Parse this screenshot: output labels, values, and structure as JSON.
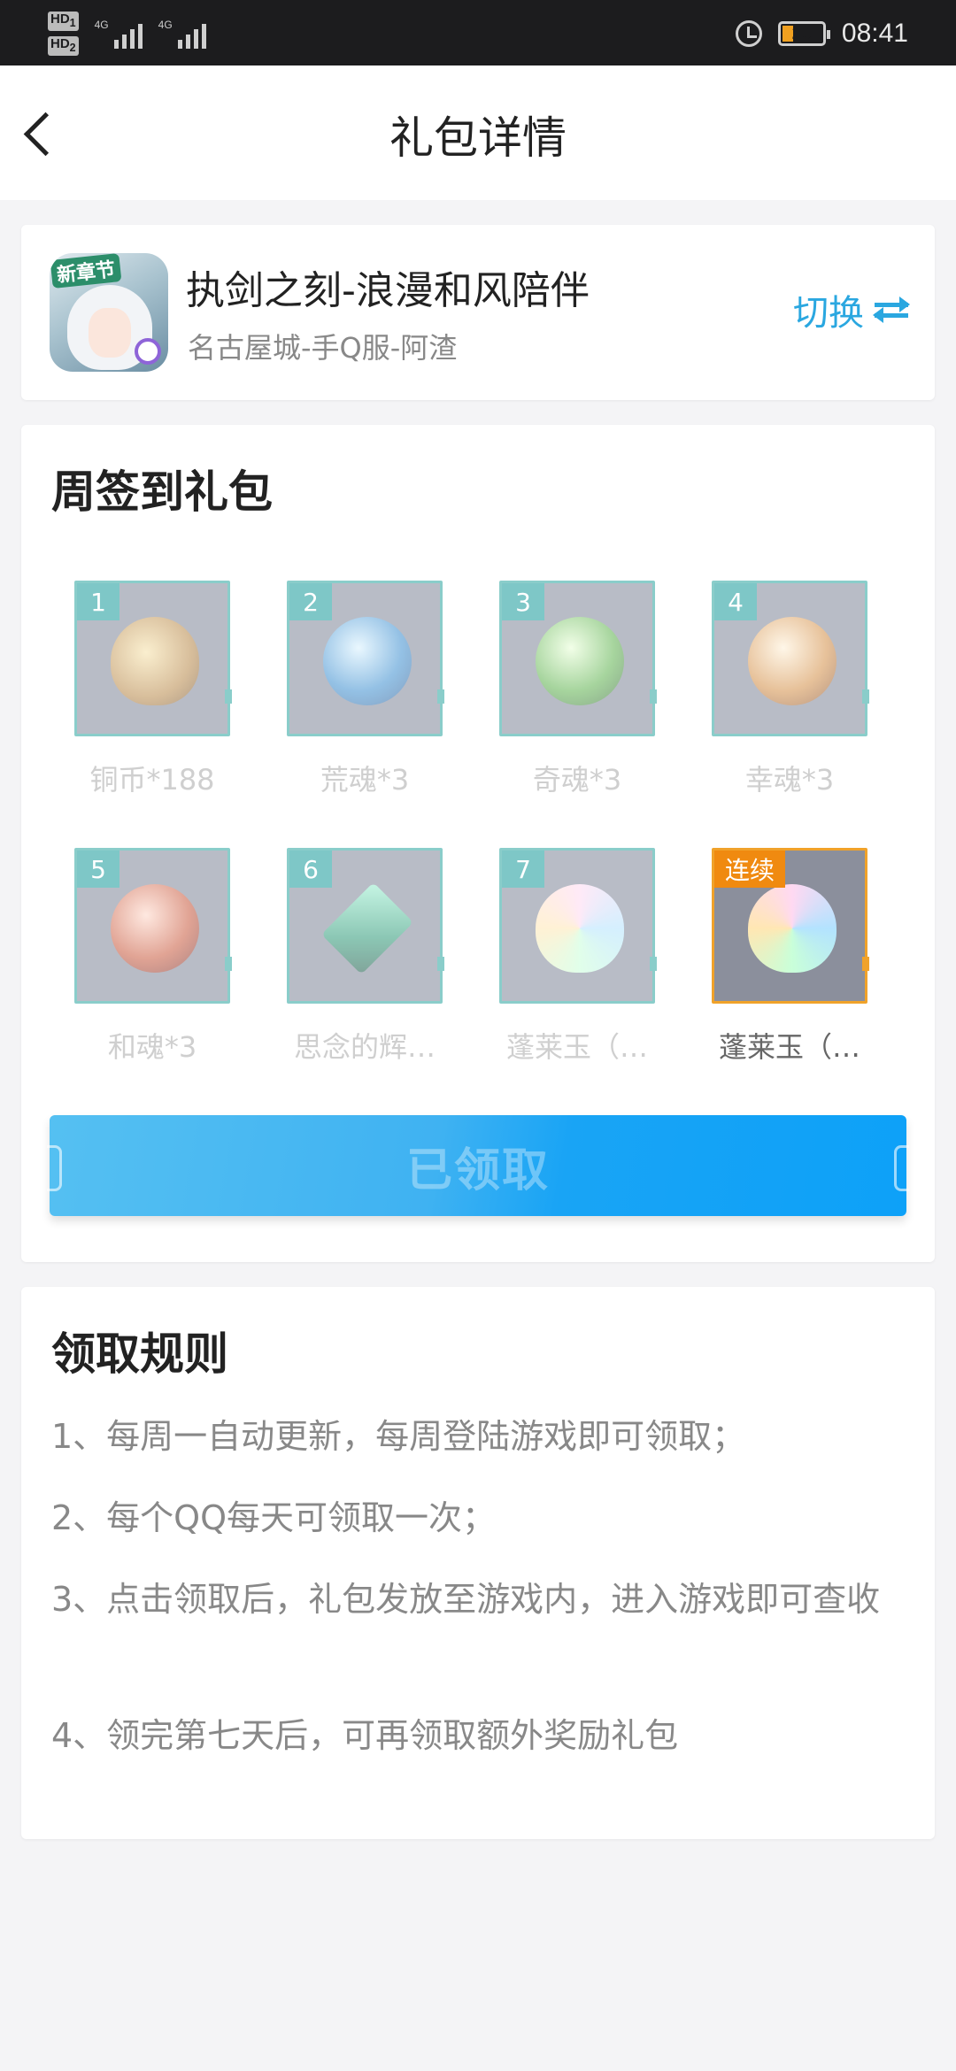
{
  "status_bar": {
    "hd1": "HD",
    "hd1_sub": "1",
    "hd2": "HD",
    "hd2_sub": "2",
    "net1": "4G",
    "net2": "4G",
    "battery": "20",
    "time": "08:41"
  },
  "header": {
    "title": "礼包详情"
  },
  "game": {
    "icon_tag": "新章节",
    "name": "执剑之刻-浪漫和风陪伴",
    "server": "名古屋城-手Q服-阿渣",
    "switch_label": "切换"
  },
  "weekly_gift": {
    "title": "周签到礼包",
    "items": [
      {
        "badge": "1",
        "name": "铜币*188",
        "icon": "copper-coin-icon",
        "active": false
      },
      {
        "badge": "2",
        "name": "荒魂*3",
        "icon": "wild-soul-icon",
        "active": false
      },
      {
        "badge": "3",
        "name": "奇魂*3",
        "icon": "rare-soul-icon",
        "active": false
      },
      {
        "badge": "4",
        "name": "幸魂*3",
        "icon": "luck-soul-icon",
        "active": false
      },
      {
        "badge": "5",
        "name": "和魂*3",
        "icon": "harmony-soul-icon",
        "active": false
      },
      {
        "badge": "6",
        "name": "思念的辉…",
        "icon": "crystal-icon",
        "active": false
      },
      {
        "badge": "7",
        "name": "蓬莱玉（…",
        "icon": "jade-icon",
        "active": false
      },
      {
        "badge": "连续",
        "name": "蓬莱玉（…",
        "icon": "jade-icon",
        "active": true
      }
    ],
    "button_label": "已领取"
  },
  "rules": {
    "title": "领取规则",
    "items": [
      "1、每周一自动更新，每周登陆游戏即可领取；",
      "2、每个QQ每天可领取一次；",
      "3、点击领取后，礼包发放至游戏内，进入游戏即可查收",
      "4、领完第七天后，可再领取额外奖励礼包"
    ]
  },
  "colors": {
    "accent": "#2aa7e0",
    "tile_border": "#2ba6a0",
    "tile_badge": "#159b9b",
    "active_badge": "#f08a10",
    "button": "#19a4f5"
  }
}
